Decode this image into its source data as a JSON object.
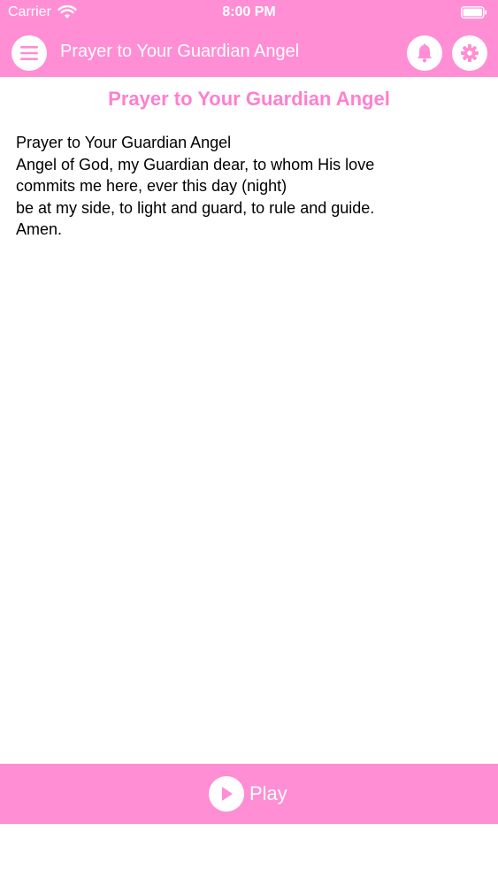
{
  "status_bar": {
    "carrier": "Carrier",
    "time": "8:00 PM",
    "wifi_icon": "wifi-icon",
    "battery_icon": "battery-icon"
  },
  "navbar": {
    "title": "Prayer to Your Guardian Angel",
    "menu_icon": "menu-icon",
    "bell_icon": "bell-icon",
    "settings_icon": "gear-icon"
  },
  "content": {
    "title": "Prayer to Your Guardian Angel",
    "lines": [
      "Prayer to Your Guardian Angel",
      "Angel of God, my Guardian dear, to whom His love",
      "commits me here, ever this day (night)",
      "be at my side, to light and guard, to rule and guide.",
      "Amen."
    ]
  },
  "bottom_bar": {
    "play_label": "Play",
    "play_icon": "play-icon"
  },
  "colors": {
    "accent": "#ff8ed4",
    "title_pink": "#ff7fd0",
    "text": "#000000",
    "background": "#ffffff"
  }
}
